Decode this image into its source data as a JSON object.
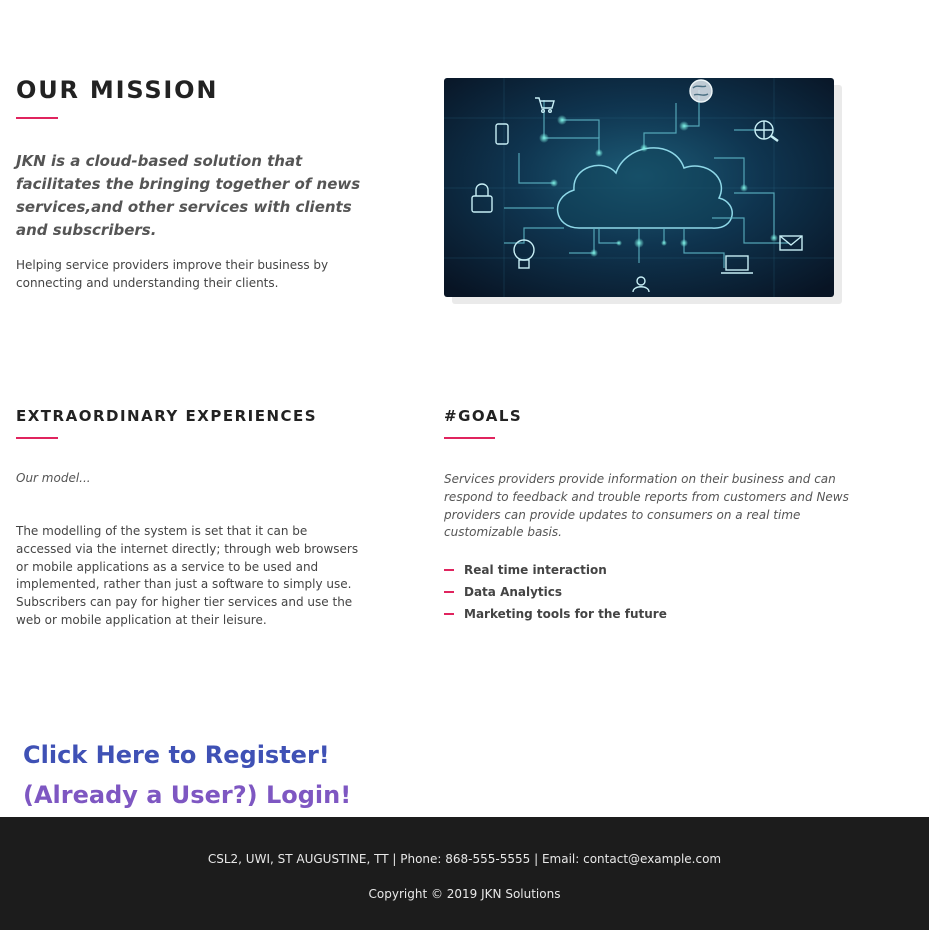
{
  "mission": {
    "title": "OUR MISSION",
    "tagline": "JKN is a cloud-based solution that facilitates the bringing together of news services,and other services with clients and subscribers.",
    "body": "Helping service providers improve their business by connecting and understanding their clients."
  },
  "experiences": {
    "title": "EXTRAORDINARY EXPERIENCES",
    "model_label": "Our model...",
    "body": "The modelling of the system is set that it can be accessed via the internet directly; through web browsers or mobile applications as a service to be used and implemented, rather than just a software to simply use. Subscribers can pay for higher tier services and use the web or mobile application at their leisure."
  },
  "goals": {
    "title": "#GOALS",
    "body": "Services providers provide information on their business and can respond to feedback and trouble reports from customers and News providers can provide updates to consumers on a real time customizable basis.",
    "items": [
      "Real time interaction",
      "Data Analytics",
      "Marketing tools for the future"
    ]
  },
  "links": {
    "register": "Click Here to Register!",
    "login": "(Already a User?) Login!"
  },
  "footer": {
    "contact": "CSL2, UWI, ST AUGUSTINE, TT | Phone: 868-555-5555 | Email: contact@example.com",
    "copyright": "Copyright © 2019 JKN Solutions"
  },
  "colors": {
    "accent": "#e0245e",
    "register_link": "#3f51b5",
    "login_link": "#7e57c2",
    "footer_bg": "#1c1c1c"
  },
  "icons": [
    "cart-icon",
    "globe-icon",
    "phone-icon",
    "search-globe-icon",
    "lock-icon",
    "lightbulb-icon",
    "mail-icon",
    "laptop-icon",
    "user-icon",
    "cloud-icon"
  ]
}
